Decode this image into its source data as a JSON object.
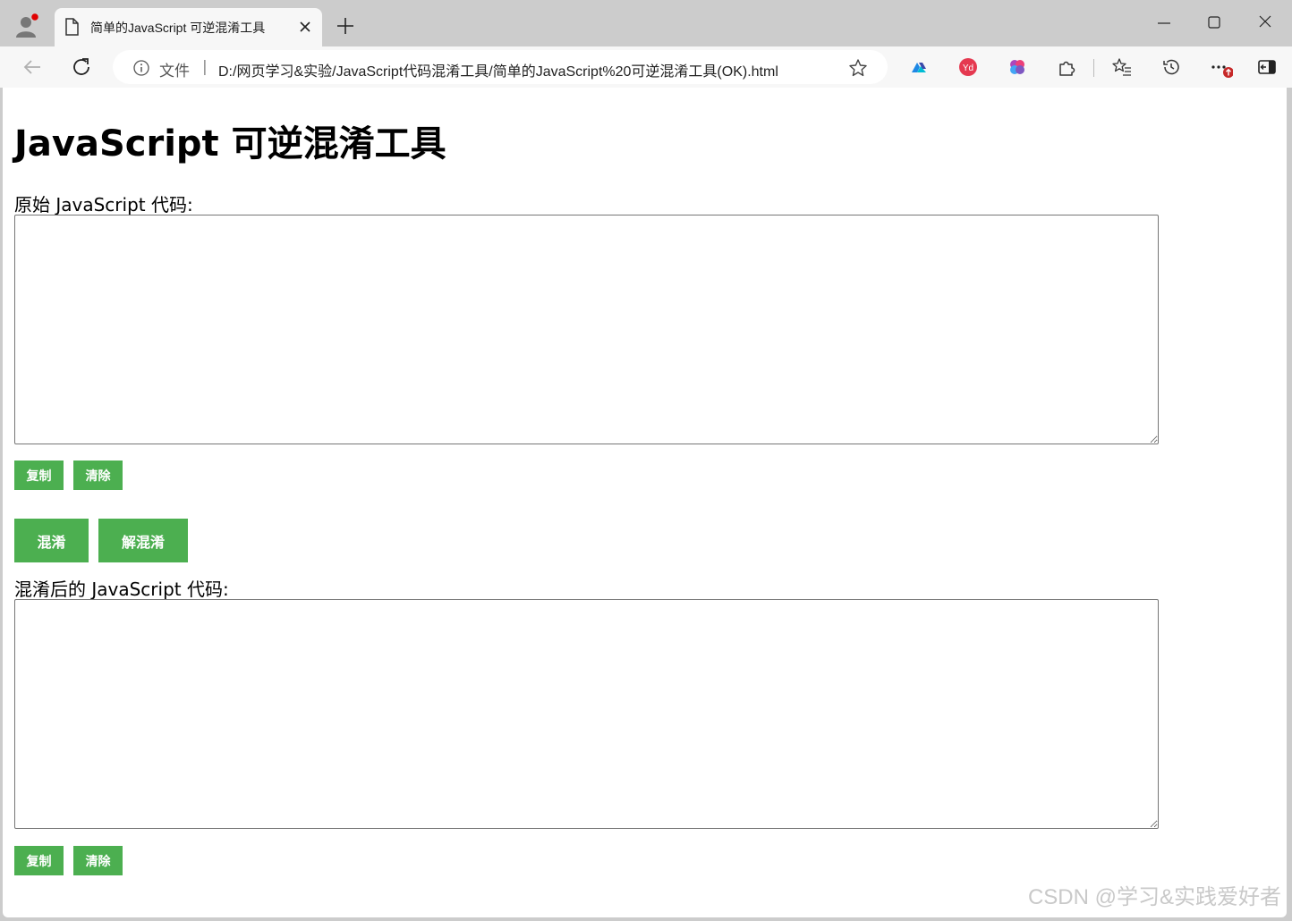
{
  "browser": {
    "tab_title": "简单的JavaScript 可逆混淆工具",
    "address": {
      "security_label": "文件",
      "separator": "|",
      "url": "D:/网页学习&实验/JavaScript代码混淆工具/简单的JavaScript%20可逆混淆工具(OK).html"
    },
    "icons": {
      "profile": "profile-avatar-icon",
      "tab": "document-icon",
      "close": "close-icon",
      "new_tab": "plus-icon",
      "back": "back-arrow-icon",
      "reload": "reload-icon",
      "info": "info-icon",
      "favorite": "star-icon",
      "extensions": [
        "drive-extension-icon",
        "youdao-extension-icon",
        "brain-extension-icon",
        "puzzle-extensions-icon"
      ],
      "favorites": "favorites-list-icon",
      "history": "history-icon",
      "more": "more-icon",
      "sidebar": "sidebar-toggle-icon"
    }
  },
  "page": {
    "title": "JavaScript 可逆混淆工具",
    "original_label": "原始 JavaScript 代码:",
    "original_value": "",
    "original_copy": "复制",
    "original_clear": "清除",
    "obfuscate": "混淆",
    "deobfuscate": "解混淆",
    "obfuscated_label": "混淆后的 JavaScript 代码:",
    "obfuscated_value": "",
    "obfuscated_copy": "复制",
    "obfuscated_clear": "清除",
    "accent_color": "#4caf50"
  },
  "watermark": "CSDN @学习&实践爱好者"
}
